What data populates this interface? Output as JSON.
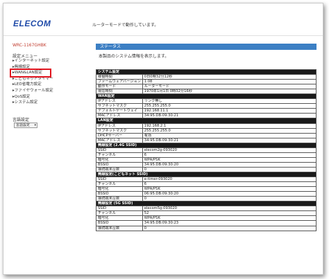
{
  "header": {
    "logo": "ELECOM",
    "mode": "ルーターモードで動作しています。"
  },
  "sidebar": {
    "model": "WRC-1167GHBK",
    "menu_title": "設定メニュー",
    "items": [
      {
        "label": "▸インターネット設定"
      },
      {
        "label": "▸無線設定"
      },
      {
        "label": "▸WAN&LAN設定"
      },
      {
        "label": "▸こどもネットタイマー"
      },
      {
        "label": "▸LED省電力設定"
      },
      {
        "label": "▸ファイヤウォール設定"
      },
      {
        "label": "▸QoS設定"
      },
      {
        "label": "▸システム設定"
      }
    ],
    "language_label": "言語設定",
    "language_value": "言語設定"
  },
  "main": {
    "section_title": "ステータス",
    "description": "本製品のシステム情報を表示します。",
    "sections": [
      {
        "title": "システム設定",
        "rows": [
          [
            "稼働時間",
            "0日0時32分12秒"
          ],
          [
            "ファームウェアバージョン",
            "1.08"
          ],
          [
            "動作モード",
            "ルーターモード"
          ],
          [
            "現在時刻",
            "1970年1月1日 0時32分16秒"
          ]
        ]
      },
      {
        "title": "WAN設定",
        "rows": [
          [
            "IPアドレス",
            "リンク無し"
          ],
          [
            "サブネットマスク",
            "255.255.255.0"
          ],
          [
            "デフォルトゲートウェイ",
            "192.168.11.1"
          ],
          [
            "MACアドレス",
            "34:95:DB:09:30:21"
          ]
        ]
      },
      {
        "title": "LAN設定",
        "rows": [
          [
            "IPアドレス",
            "192.168.2.1"
          ],
          [
            "サブネットマスク",
            "255.255.255.0"
          ],
          [
            "DHCPサーバー",
            "有効"
          ],
          [
            "MACアドレス",
            "34:95:DB:09:30:21"
          ]
        ]
      },
      {
        "title": "無線設定 (2.4G SSID)",
        "rows": [
          [
            "SSID",
            "elecom2g-093020"
          ],
          [
            "チャンネル",
            "6"
          ],
          [
            "暗号化",
            "WPA/PSK"
          ],
          [
            "BSSID",
            "34:95:DB:09:30:20"
          ],
          [
            "接続端末台数",
            "0"
          ]
        ]
      },
      {
        "title": "無線設定(こどもネット SSID)",
        "rows": [
          [
            "SSID",
            "e-timer-093020"
          ],
          [
            "チャンネル",
            "6"
          ],
          [
            "暗号化",
            "WPA/PSK"
          ],
          [
            "BSSID",
            "06:95:DB:09:30:20"
          ],
          [
            "接続端末台数",
            "0"
          ]
        ]
      },
      {
        "title": "無線設定 (5G SSID)",
        "rows": [
          [
            "SSID",
            "elecom5g-093020"
          ],
          [
            "チャンネル",
            "52"
          ],
          [
            "暗号化",
            "WPA/PSK"
          ],
          [
            "BSSID",
            "34:95:DB:09:30:23"
          ],
          [
            "接続端末台数",
            "0"
          ]
        ]
      }
    ]
  },
  "colors": {
    "logo": "#1f4aa8",
    "status_bar": "#3c7fc4",
    "section_header": "#1a1a1a",
    "highlight": "#e0141e",
    "model_text": "#c0392b"
  }
}
